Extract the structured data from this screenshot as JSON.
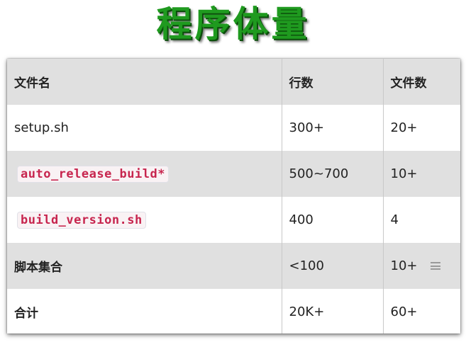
{
  "title": "程序体量",
  "table": {
    "headers": [
      "文件名",
      "行数",
      "文件数"
    ],
    "rows": [
      {
        "name": "setup.sh",
        "lines": "300+",
        "files": "20+"
      },
      {
        "name": "auto_release_build*",
        "lines": "500~700",
        "files": "10+"
      },
      {
        "name": "build_version.sh",
        "lines": "400",
        "files": "4"
      },
      {
        "name": "脚本集合",
        "lines": "<100",
        "files": "10+"
      },
      {
        "name": "合计",
        "lines": "20K+",
        "files": "60+"
      }
    ]
  },
  "icons": {
    "row_menu": "menu-icon"
  },
  "colors": {
    "title": "#1f9a1f",
    "code_text": "#c7254e",
    "stripe": "#e0e0e0"
  }
}
